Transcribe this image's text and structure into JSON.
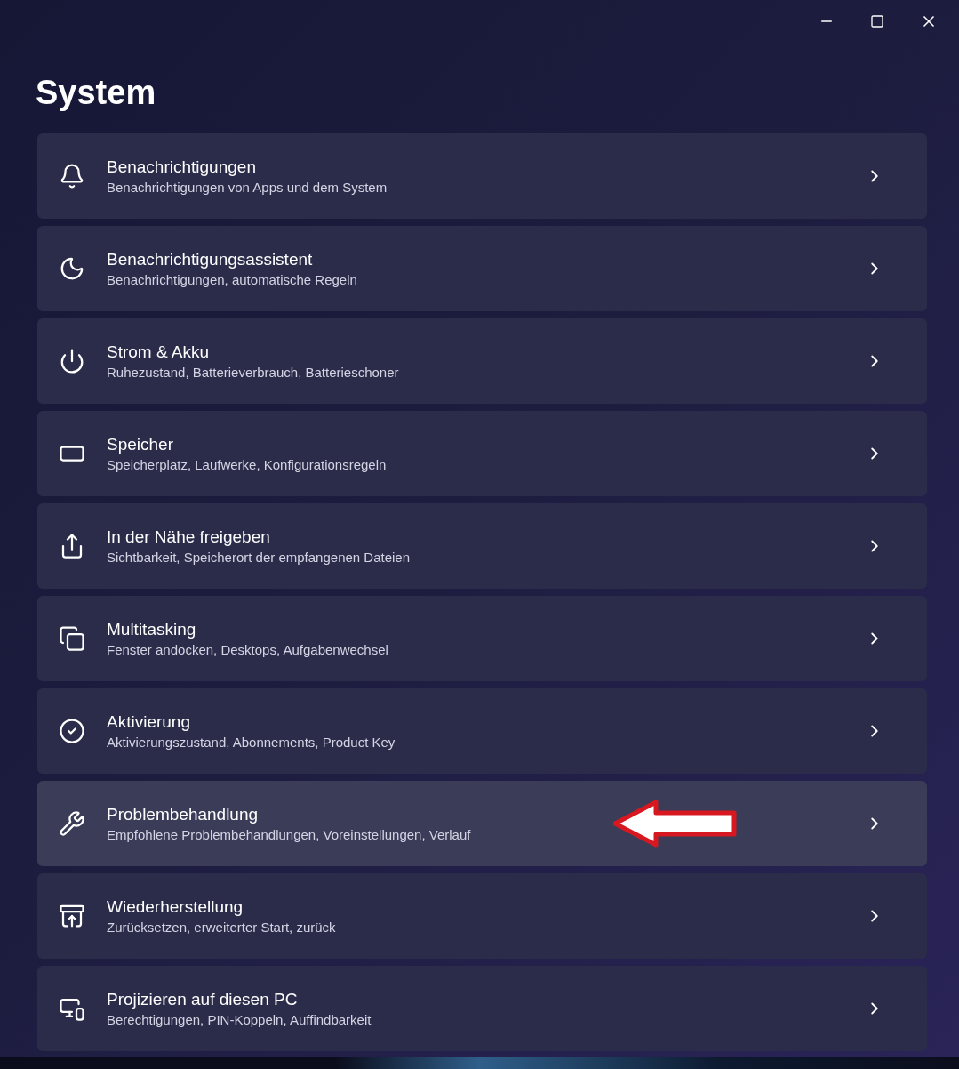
{
  "window": {
    "title": "System"
  },
  "items": [
    {
      "kind": "bell",
      "title": "Benachrichtigungen",
      "subtitle": "Benachrichtigungen von Apps und dem System",
      "hovered": false,
      "annotated": false
    },
    {
      "kind": "moon",
      "title": "Benachrichtigungsassistent",
      "subtitle": "Benachrichtigungen, automatische Regeln",
      "hovered": false,
      "annotated": false
    },
    {
      "kind": "power",
      "title": "Strom & Akku",
      "subtitle": "Ruhezustand, Batterieverbrauch, Batterieschoner",
      "hovered": false,
      "annotated": false
    },
    {
      "kind": "storage",
      "title": "Speicher",
      "subtitle": "Speicherplatz, Laufwerke, Konfigurationsregeln",
      "hovered": false,
      "annotated": false
    },
    {
      "kind": "share",
      "title": "In der Nähe freigeben",
      "subtitle": "Sichtbarkeit, Speicherort der empfangenen Dateien",
      "hovered": false,
      "annotated": false
    },
    {
      "kind": "multitask",
      "title": "Multitasking",
      "subtitle": "Fenster andocken, Desktops, Aufgabenwechsel",
      "hovered": false,
      "annotated": false
    },
    {
      "kind": "check",
      "title": "Aktivierung",
      "subtitle": "Aktivierungszustand, Abonnements, Product Key",
      "hovered": false,
      "annotated": false
    },
    {
      "kind": "wrench",
      "title": "Problembehandlung",
      "subtitle": "Empfohlene Problembehandlungen, Voreinstellungen, Verlauf",
      "hovered": true,
      "annotated": true
    },
    {
      "kind": "restore",
      "title": "Wiederherstellung",
      "subtitle": "Zurücksetzen, erweiterter Start, zurück",
      "hovered": false,
      "annotated": false
    },
    {
      "kind": "project",
      "title": "Projizieren auf diesen PC",
      "subtitle": "Berechtigungen, PIN-Koppeln, Auffindbarkeit",
      "hovered": false,
      "annotated": false
    }
  ]
}
